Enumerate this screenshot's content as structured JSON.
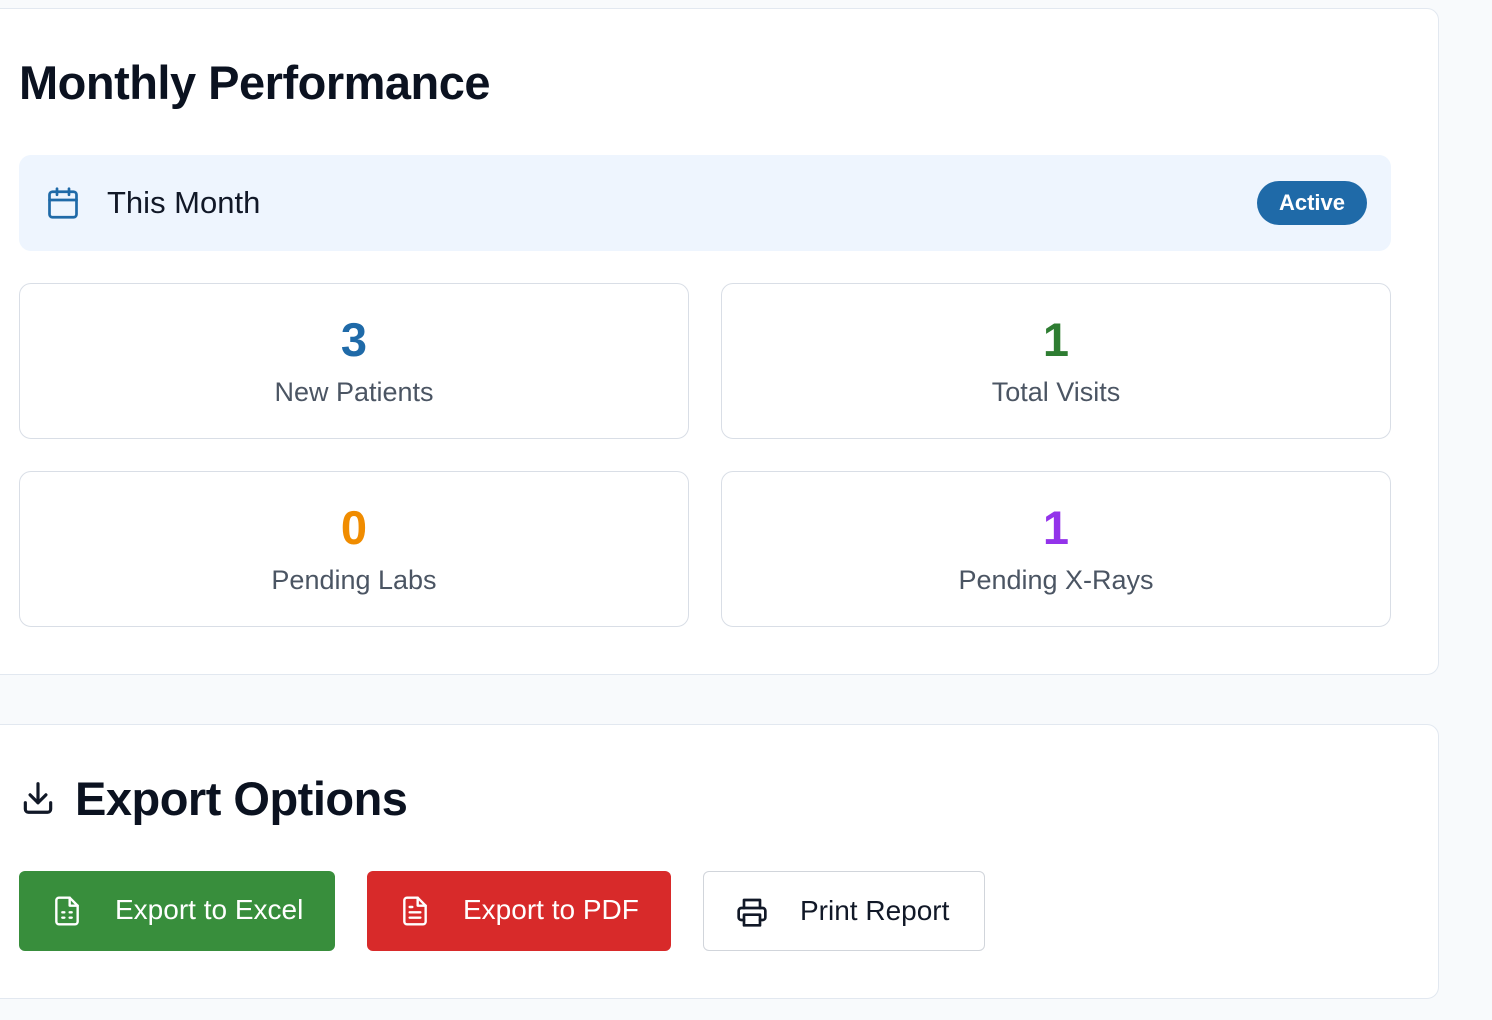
{
  "performance": {
    "title": "Monthly Performance",
    "period": {
      "label": "This Month",
      "icon": "calendar-icon",
      "badge": "Active"
    },
    "stats": [
      {
        "value": "3",
        "label": "New Patients",
        "color": "#1f6aa8"
      },
      {
        "value": "1",
        "label": "Total Visits",
        "color": "#2e7d32"
      },
      {
        "value": "0",
        "label": "Pending Labs",
        "color": "#f08c00"
      },
      {
        "value": "1",
        "label": "Pending X-Rays",
        "color": "#9333ea"
      }
    ]
  },
  "export": {
    "title": "Export Options",
    "icon": "download-icon",
    "buttons": [
      {
        "label": "Export to Excel",
        "icon": "spreadsheet-file-icon",
        "color": "#388e3c"
      },
      {
        "label": "Export to PDF",
        "icon": "document-file-icon",
        "color": "#d82a2a"
      },
      {
        "label": "Print Report",
        "icon": "printer-icon",
        "color": "#ffffff"
      }
    ]
  },
  "colors": {
    "accent": "#1f6aa8",
    "period_bg": "#eef5fe",
    "page_bg": "#f8fafc"
  }
}
